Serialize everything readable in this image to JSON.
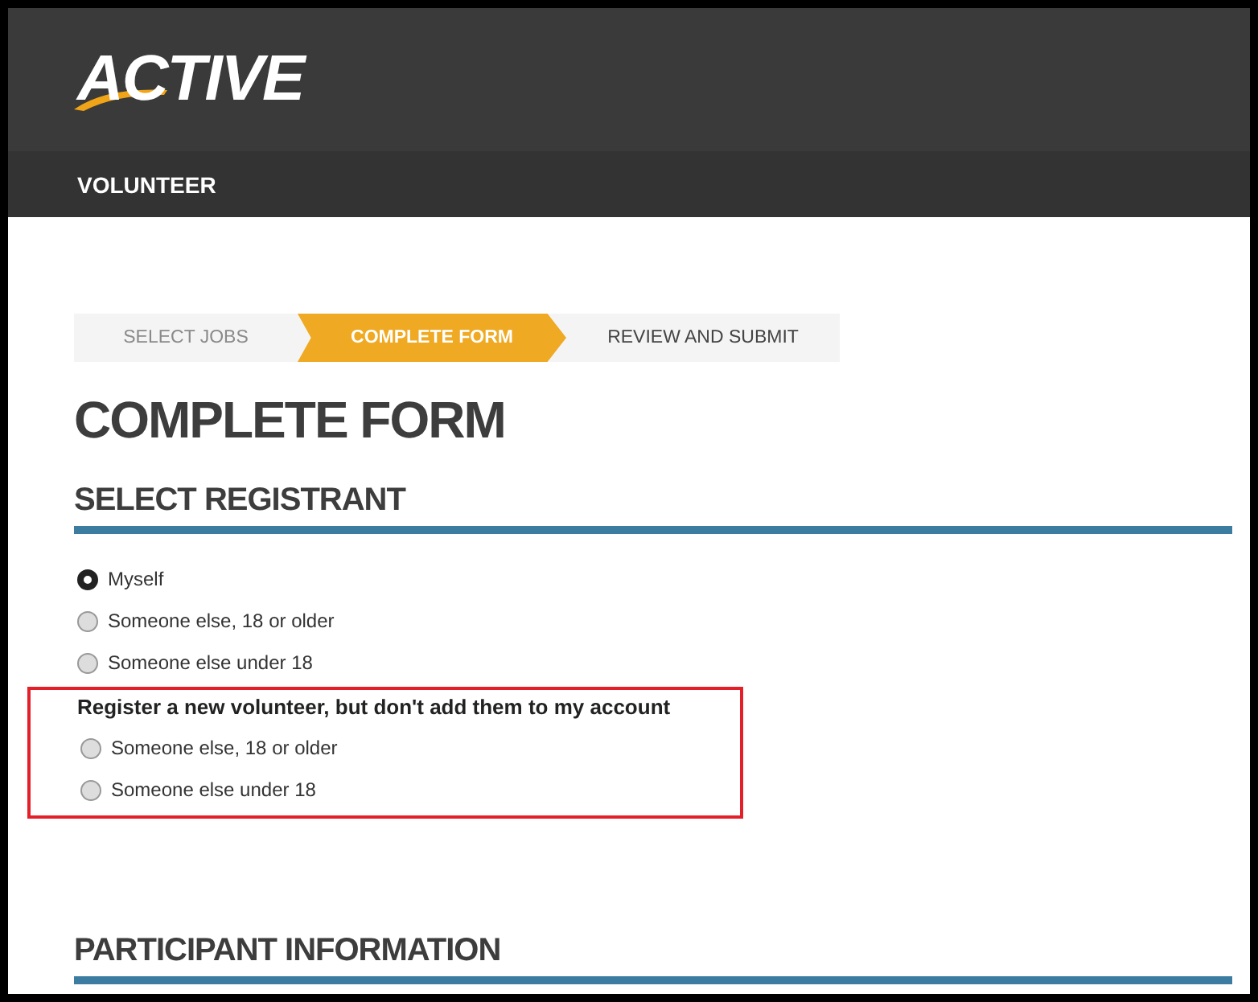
{
  "header": {
    "logo": "ACTIVE"
  },
  "nav": {
    "label": "VOLUNTEER"
  },
  "steps": [
    {
      "label": "SELECT JOBS",
      "selected": false,
      "done": true
    },
    {
      "label": "COMPLETE FORM",
      "selected": true,
      "done": false
    },
    {
      "label": "REVIEW AND SUBMIT",
      "selected": false,
      "done": false
    }
  ],
  "title": "COMPLETE FORM",
  "sections": [
    {
      "heading": "SELECT REGISTRANT",
      "options": [
        {
          "label": "Myself",
          "selected": true
        },
        {
          "label": "Someone else, 18 or older",
          "selected": false
        },
        {
          "label": "Someone else under 18",
          "selected": false
        }
      ],
      "highlighted_group": {
        "heading": "Register a new volunteer, but don't add them to my account",
        "options": [
          {
            "label": "Someone else, 18 or older",
            "selected": false
          },
          {
            "label": "Someone else under 18",
            "selected": false
          }
        ]
      }
    },
    {
      "heading": "PARTICIPANT INFORMATION"
    }
  ]
}
